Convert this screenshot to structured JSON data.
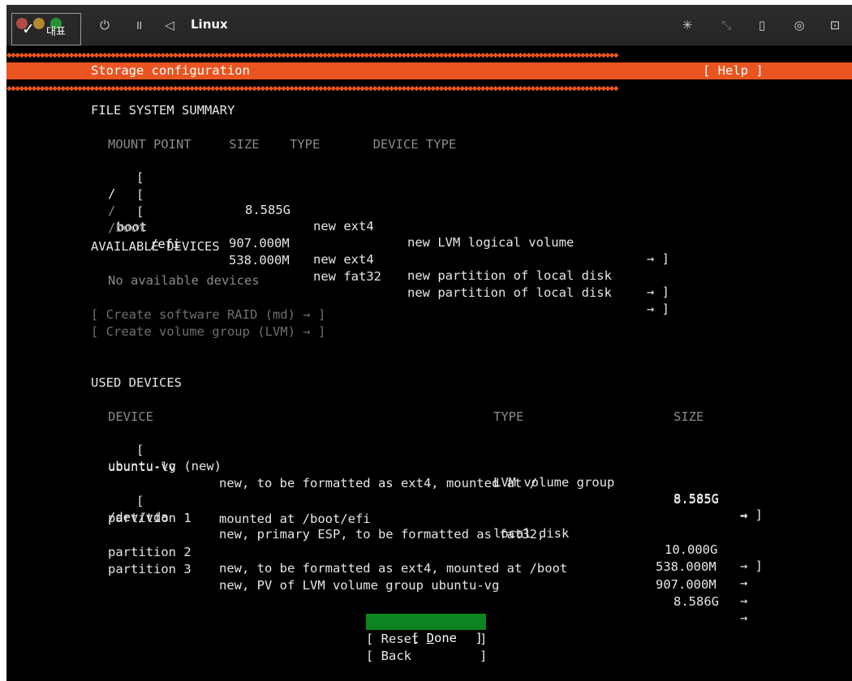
{
  "window": {
    "title": "Linux",
    "badge_text": "대표"
  },
  "toolbar": {
    "power_icon": "⏻",
    "pause_icon": "॥",
    "back_icon": "◁",
    "right_icons": [
      "✳",
      "⤡",
      "▯",
      "◎",
      "⊡"
    ]
  },
  "header": {
    "title": "Storage configuration",
    "help": "[ Help ]"
  },
  "fs_summary": {
    "heading": "FILE SYSTEM SUMMARY",
    "columns": "MOUNT POINT     SIZE    TYPE       DEVICE TYPE",
    "rows": [
      {
        "open": "[",
        "mount_a": "/",
        "mount_b": "",
        "mount_c": "",
        "size": "8.585G",
        "type": "new ext4",
        "device": "new LVM logical volume",
        "close": "→ ]"
      },
      {
        "open": "[",
        "mount_a": "/",
        "mount_b": "boot",
        "mount_c": "",
        "size": "907.000M",
        "type": "new ext4",
        "device": "new partition of local disk",
        "close": "→ ]"
      },
      {
        "open": "[",
        "mount_a": "/boot",
        "mount_b": "/efi",
        "mount_c": "",
        "size": "538.000M",
        "type": "new fat32",
        "device": "new partition of local disk",
        "close": "→ ]"
      }
    ]
  },
  "available": {
    "heading": "AVAILABLE DEVICES",
    "none": "No available devices",
    "raid": "[ Create software RAID (md) → ]",
    "lvm": "[ Create volume group (LVM) → ]"
  },
  "used": {
    "heading": "USED DEVICES",
    "col_device": "DEVICE",
    "col_type": "TYPE",
    "col_size": "SIZE",
    "vg": {
      "open": "[",
      "name": "ubuntu-vg (new)",
      "type": "LVM volume group",
      "size": "8.585G",
      "close": "→ ]"
    },
    "lv": {
      "name": "ubuntu-lv",
      "desc": "new, to be formatted as ext4, mounted at /",
      "size": "8.585G",
      "arrow": "→"
    },
    "disk": {
      "open": "[",
      "name": "/dev/vda",
      "type": "local disk",
      "size": "10.000G",
      "close": "→ ]"
    },
    "p1": {
      "name": "partition 1",
      "desc": "new, primary ESP, to be formatted as fat32,",
      "desc2": "mounted at /boot/efi",
      "size": "538.000M",
      "arrow": "→"
    },
    "p2": {
      "name": "partition 2",
      "desc": "new, to be formatted as ext4, mounted at /boot",
      "size": "907.000M",
      "arrow": "→"
    },
    "p3": {
      "name": "partition 3",
      "desc": "new, PV of LVM volume group ubuntu-vg",
      "size": "8.586G",
      "arrow": "→"
    }
  },
  "buttons": {
    "done_open": "[ ",
    "done_key": "D",
    "done_rest": "one",
    "done_close": "]",
    "reset": "[ Reset        ]",
    "back": "[ Back         ]"
  },
  "colors": {
    "accent": "#e95420",
    "done_bg": "#0e8420",
    "screen_bg": "#000000"
  }
}
